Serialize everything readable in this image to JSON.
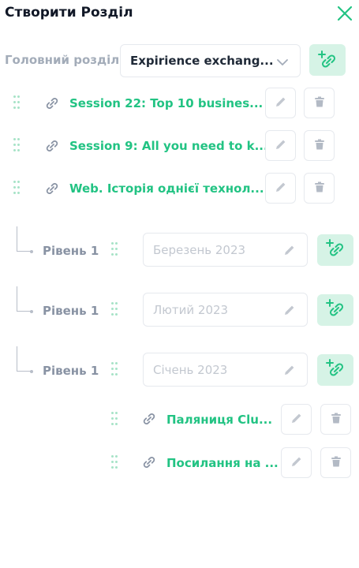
{
  "header": {
    "title": "Створити Розділ",
    "close_icon": "close-icon"
  },
  "main_section": {
    "label": "Головний розділ",
    "selected": "Expirience exchang..."
  },
  "links": [
    {
      "label": "Session 22: Top 10 busines..."
    },
    {
      "label": "Session 9: All you need to k..."
    },
    {
      "label": "Web. Історія однієї технол..."
    }
  ],
  "levels": [
    {
      "label": "Рівень 1",
      "placeholder": "Березень 2023"
    },
    {
      "label": "Рівень 1",
      "placeholder": "Лютий 2023"
    },
    {
      "label": "Рівень 1",
      "placeholder": "Січень 2023"
    }
  ],
  "sub_links": [
    {
      "label": "Паляниця Clu..."
    },
    {
      "label": "Посилання на ..."
    }
  ],
  "colors": {
    "accent": "#22c383",
    "accent_bg": "#d6f3e6",
    "muted_text": "#8993a4",
    "placeholder": "#c3c8d0",
    "border": "#e6e9ee"
  }
}
